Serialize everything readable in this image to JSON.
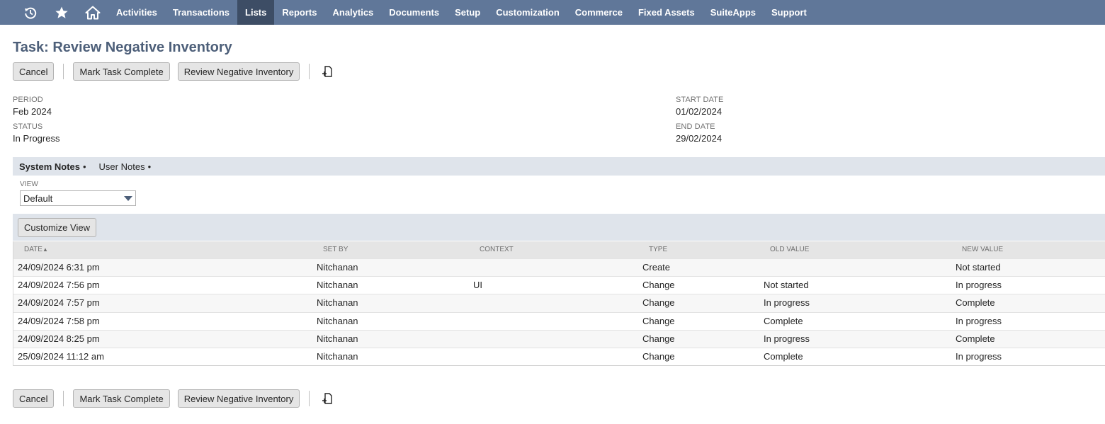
{
  "nav": {
    "icons": [
      "recent-records-icon",
      "star-icon",
      "home-icon"
    ],
    "items": [
      {
        "label": "Activities",
        "active": false
      },
      {
        "label": "Transactions",
        "active": false
      },
      {
        "label": "Lists",
        "active": true
      },
      {
        "label": "Reports",
        "active": false
      },
      {
        "label": "Analytics",
        "active": false
      },
      {
        "label": "Documents",
        "active": false
      },
      {
        "label": "Setup",
        "active": false
      },
      {
        "label": "Customization",
        "active": false
      },
      {
        "label": "Commerce",
        "active": false
      },
      {
        "label": "Fixed Assets",
        "active": false
      },
      {
        "label": "SuiteApps",
        "active": false
      },
      {
        "label": "Support",
        "active": false
      }
    ],
    "colors": {
      "bar": "#607799",
      "active": "#3d4d65"
    }
  },
  "page": {
    "title": "Task: Review Negative Inventory"
  },
  "actions": {
    "cancel": "Cancel",
    "mark_complete": "Mark Task Complete",
    "review": "Review Negative Inventory",
    "print_icon": "print-icon"
  },
  "fields": {
    "period": {
      "label": "PERIOD",
      "value": "Feb 2024"
    },
    "status": {
      "label": "STATUS",
      "value": "In Progress"
    },
    "start_date": {
      "label": "START DATE",
      "value": "01/02/2024"
    },
    "end_date": {
      "label": "END DATE",
      "value": "29/02/2024"
    }
  },
  "subtabs": [
    {
      "label": "System Notes",
      "active": true,
      "dot": "•"
    },
    {
      "label": "User Notes",
      "active": false,
      "dot": "•"
    }
  ],
  "view": {
    "label": "VIEW",
    "selected": "Default"
  },
  "customize_view": "Customize View",
  "table": {
    "headers": {
      "date": "DATE",
      "sort_indicator": "▲",
      "set_by": "SET BY",
      "context": "CONTEXT",
      "type": "TYPE",
      "old_value": "OLD VALUE",
      "new_value": "NEW VALUE"
    },
    "rows": [
      {
        "date": "24/09/2024 6:31 pm",
        "set_by": "Nitchanan",
        "context": "",
        "type": "Create",
        "old_value": "",
        "new_value": "Not started"
      },
      {
        "date": "24/09/2024 7:56 pm",
        "set_by": "Nitchanan",
        "context": "UI",
        "type": "Change",
        "old_value": "Not started",
        "new_value": "In progress"
      },
      {
        "date": "24/09/2024 7:57 pm",
        "set_by": "Nitchanan",
        "context": "",
        "type": "Change",
        "old_value": "In progress",
        "new_value": "Complete"
      },
      {
        "date": "24/09/2024 7:58 pm",
        "set_by": "Nitchanan",
        "context": "",
        "type": "Change",
        "old_value": "Complete",
        "new_value": "In progress"
      },
      {
        "date": "24/09/2024 8:25 pm",
        "set_by": "Nitchanan",
        "context": "",
        "type": "Change",
        "old_value": "In progress",
        "new_value": "Complete"
      },
      {
        "date": "25/09/2024 11:12 am",
        "set_by": "Nitchanan",
        "context": "",
        "type": "Change",
        "old_value": "Complete",
        "new_value": "In progress"
      }
    ]
  }
}
